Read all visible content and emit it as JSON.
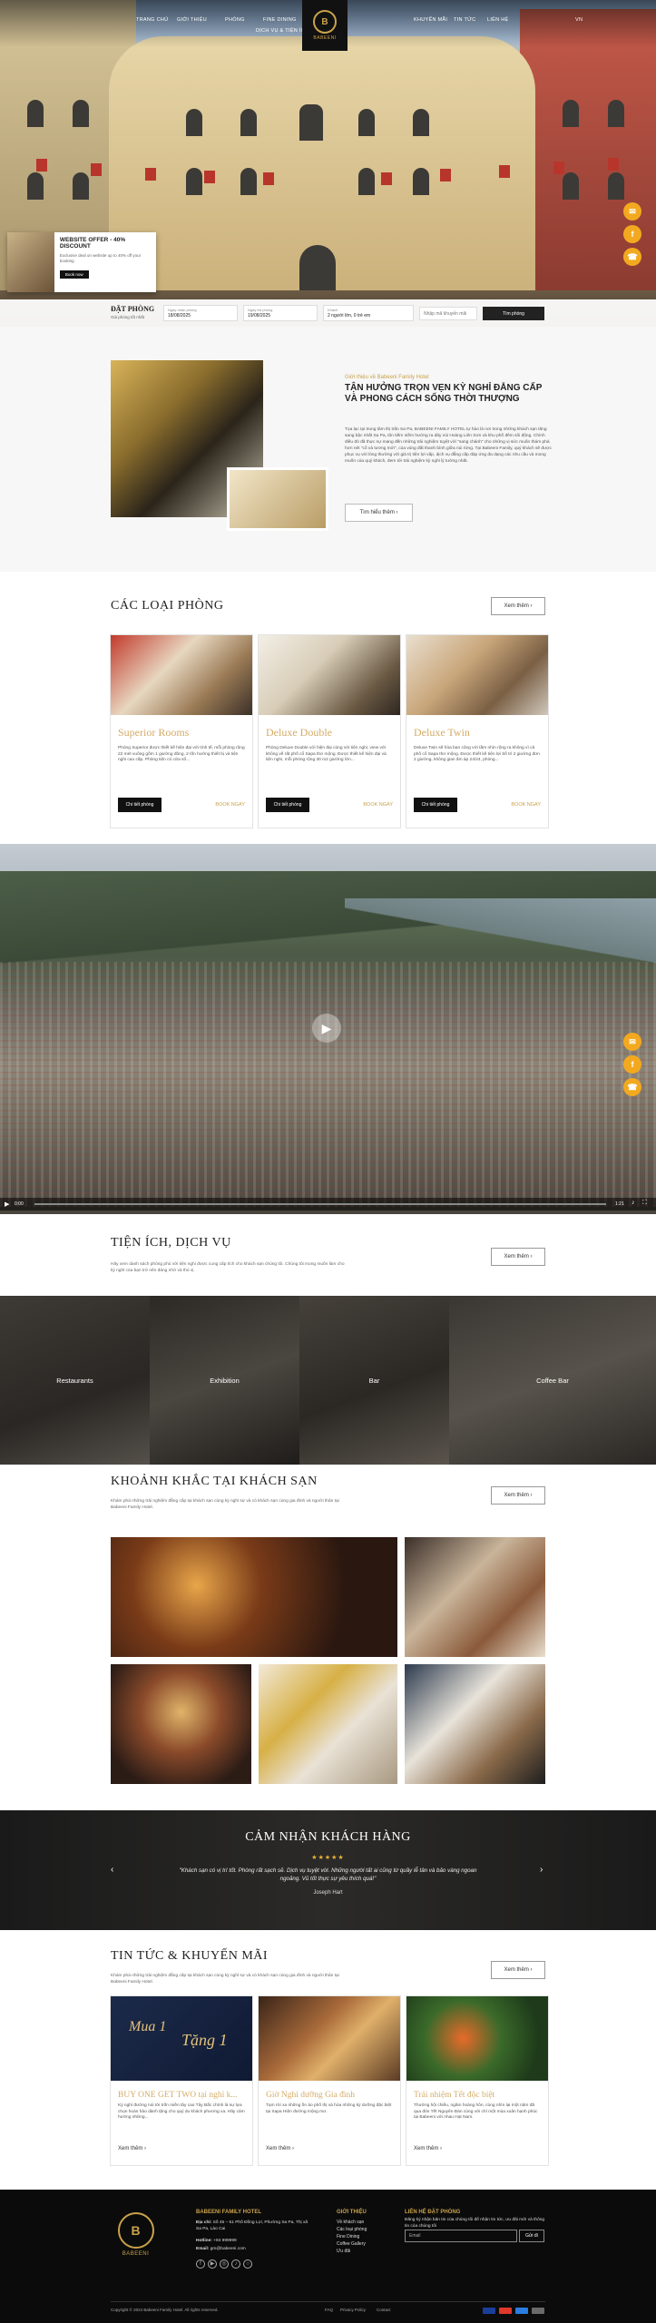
{
  "nav": {
    "left": [
      "TRANG CHỦ",
      "GIỚI THIỆU",
      "PHÒNG",
      "FINE DINING",
      "DỊCH VỤ & TIỆN ÍCH"
    ],
    "right": [
      "KHUYẾN MÃI",
      "TIN TỨC",
      "LIÊN HỆ",
      "VN"
    ],
    "logo_text": "BABEENI"
  },
  "offer": {
    "title": "WEBSITE OFFER - 40% DISCOUNT",
    "desc": "Exclusive deal on website up to 40% off your booking",
    "button": "Book now"
  },
  "booking": {
    "title": "ĐẶT PHÒNG",
    "subtitle": "Giá phòng tốt nhất",
    "checkin_label": "Ngày nhận phòng",
    "checkin_value": "18/08/2025",
    "checkout_label": "Ngày trả phòng",
    "checkout_value": "19/08/2025",
    "guests_label": "Khách",
    "guests_value": "2 người lớn, 0 trẻ em",
    "promo_placeholder": "Nhập mã khuyến mãi",
    "search_button": "Tìm phòng"
  },
  "about": {
    "kicker": "Giới thiệu về Babeeni Family Hotel",
    "title": "TẬN HƯỞNG TRỌN VẸN KỲ NGHỈ ĐẲNG CẤP VÀ PHONG CÁCH SỐNG THỜI THƯỢNG",
    "body": "Tọa lạc tại trung tâm thị trấn Sa Pa, BABEENI FAMILY HOTEL tự hào là nơi trong những khách sạn tăng sang bậc nhất Sa Pa, tôn tiếm niềm hướng ra dãy núi Hoàng Liên Sơn và khu phố đêm sôi động. Chính điều đó đã thực sự mang đến những trải nghiệm tuyệt vời \"sang chảnh\" cho những vị sức muốn thám phá hơn nét \"cổ và tương mới\", của vùng đất thanh bình giữa núi rừng. Tại Babeeni Family, quý khách sẽ được phục vụ với lòng thường với giá trị tiện lợi vấp, dịch vụ đẳng cấp đáp ứng đa dạng các nhu cầu và mong muốn của quý khách, đem tới trải nghiệm kỳ nghỉ lý tưởng nhất.",
    "button": "Tìm hiểu thêm"
  },
  "rooms": {
    "title": "CÁC LOẠI PHÒNG",
    "view_all": "Xem thêm",
    "items": [
      {
        "name": "Superior Rooms",
        "desc": "Phòng Superior được thiết kế hiện đại với tính tế, mỗi phòng rộng 22 mét vuông gồm 1 giường đông, 2 tốn hướng thiết bị và tiện nghi cao cấp. Phòng tiện có cửa sổ...",
        "detail": "Chi tiết phòng",
        "book": "BOOK NGAY"
      },
      {
        "name": "Deluxe Double",
        "desc": "Phòng Deluxe Double với hiện đại cùng với tiện nghi, view với không về rất phố cổ Sapa thơ mộng. Được thiết kế hiện đại và tiện nghi, mỗi phòng rộng 30 m2 giường lớn...",
        "detail": "Chi tiết phòng",
        "book": "BOOK NGAY"
      },
      {
        "name": "Deluxe Twin",
        "desc": "Deluxe Twin sẽ hòa ban công với tầm nhìn rộng ra không vì cả phố cổ Sapa thơ mộng. Được thiết kế tiện lợi bố trí 2 giường đơn 2 giường, không gian ấm áp 24/24, phòng...",
        "detail": "Chi tiết phòng",
        "book": "BOOK NGAY"
      }
    ]
  },
  "video": {
    "time_current": "0:00",
    "time_total": "1:21"
  },
  "amenities": {
    "title": "TIỆN ÍCH, DỊCH VỤ",
    "subtitle": "Hãy xem danh sách phòng phù với tiện nghi được cung cấp tích cho khách sạn chúng tôi. Chúng tôi mong muốn làm cho kỳ nghỉ của bạn trở nên đáng nhớ và thú vị.",
    "view_all": "Xem thêm",
    "items": [
      "Restaurants",
      "Exhibition",
      "Bar",
      "Coffee Bar"
    ]
  },
  "moments": {
    "title": "KHOẢNH KHẮC TẠI KHÁCH SẠN",
    "subtitle": "Khám phá những trải nghiệm đẳng cấp tại khách sạn cùng kỳ nghỉ sự và có khách sạn cùng gia đình và người thân tại Babeeni Family Hotel.",
    "view_all": "Xem thêm"
  },
  "testimonial": {
    "title": "CẢM NHẬN KHÁCH HÀNG",
    "stars": "★★★★★",
    "quote": "\"Khách sạn có vị trí tốt. Phòng rất sạch sẽ. Dịch vụ tuyệt vời. Những người tất ai cũng từ quầy lễ tân và bảo vàng ngoan ngoãng. Vũ tốt thực sự yêu thích quá!\"",
    "author": "Joseph Hart"
  },
  "news": {
    "title": "TIN TỨC & KHUYẾN MÃI",
    "subtitle": "Khám phá những trải nghiệm đẳng cấp tại khách sạn cùng kỳ nghỉ sự và có khách sạn cùng gia đình và người thân tại Babeeni Family Hotel.",
    "view_all": "Xem thêm",
    "items": [
      {
        "title": "BUY ONE GET TWO tại nghỉ k...",
        "desc": "Kỳ nghỉ đường núi tới trốn miền tây cao Tây Bắc chính là sự lựa chọn hoàn hảo dành tặng cho quý du khách phương xa. Hãy cảm hướng những...",
        "more": "Xem thêm",
        "hero1": "Mua 1",
        "hero2": "Tặng 1"
      },
      {
        "title": "Giờ Nghỉ dưỡng Gia đình",
        "desc": "Tạm rời xa những ồn ào phố thị và hòa những kỳ dưỡng đặc biệt tại Sapa Hiện đường mộng mơ.",
        "more": "Xem thêm"
      },
      {
        "title": "Trải nhiệm Tết độc biệt",
        "desc": "Thưởng hội chiều, ngăm hoàng hôn, cùng nhìn lại một năm đã qua đón Tết Nguyên Đán cùng với chí một mùa xuân hạnh phúc tại Babeeni với nhau Hạt Nam.",
        "more": "Xem thêm"
      }
    ]
  },
  "footer": {
    "logo_text": "BABEENI",
    "hotel_name": "BABEENI FAMILY HOTEL",
    "address_label": "Địa chỉ:",
    "address": "Số 45 – 51 Phố Đồng Lợi, Phường Sa Pa, Thị xã Sa Pa, Lào Cai",
    "hotline_label": "Hotline:",
    "hotline": "+84 999999",
    "email_label": "Email:",
    "email": "gm@babeeni.com",
    "about_heading": "GIỚI THIỆU",
    "about_links": [
      "Về khách sạn",
      "Các loại phòng",
      "Fine Dining",
      "Coffee Gallery",
      "Ưu đãi"
    ],
    "contact_heading": "LIÊN HỆ ĐẶT PHÒNG",
    "contact_text": "Đăng ký nhận bản tin của chúng tôi để nhận tin tức, ưu đãi mới và thông tin của chúng tôi",
    "email_placeholder": "Email",
    "subscribe": "Gửi đi",
    "copyright": "Copyright © 2024 Babeeni Family Hotel. All rights reserved.",
    "links": [
      "FAQ",
      "Privacy Policy",
      "Contact"
    ]
  }
}
